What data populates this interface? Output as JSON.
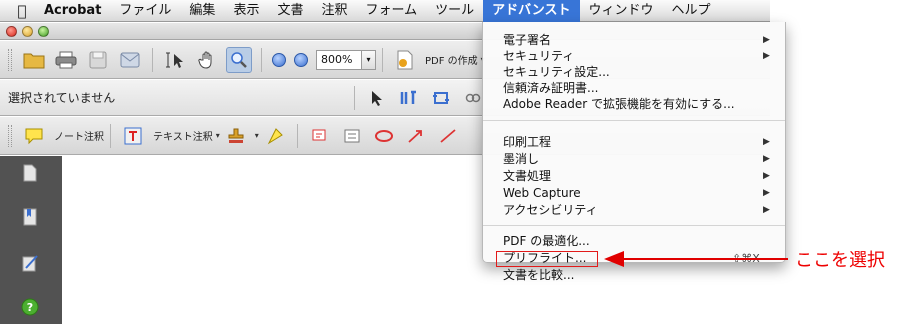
{
  "menubar": {
    "apple": "",
    "items": [
      "Acrobat",
      "ファイル",
      "編集",
      "表示",
      "文書",
      "注釈",
      "フォーム",
      "ツール",
      "アドバンスト",
      "ウィンドウ",
      "ヘルプ"
    ]
  },
  "toolbar1": {
    "zoom_value": "800%",
    "pdf_create_label": "PDF の作成"
  },
  "toolbar2": {
    "status": "選択されていません"
  },
  "toolbar3": {
    "note_comment": "ノート注釈",
    "text_edit_comment": "テキスト注釈"
  },
  "menu": {
    "group1": [
      {
        "label": "電子署名",
        "submenu": true
      },
      {
        "label": "セキュリティ",
        "submenu": true
      },
      {
        "label": "セキュリティ設定...",
        "submenu": false
      },
      {
        "label": "信頼済み証明書...",
        "submenu": false
      },
      {
        "label": "Adobe Reader で拡張機能を有効にする...",
        "submenu": false
      }
    ],
    "group2": [
      {
        "label": "印刷工程",
        "submenu": true
      },
      {
        "label": "墨消し",
        "submenu": true
      },
      {
        "label": "文書処理",
        "submenu": true
      },
      {
        "label": "Web Capture",
        "submenu": true
      },
      {
        "label": "アクセシビリティ",
        "submenu": true
      }
    ],
    "group3": [
      {
        "label": "PDF の最適化...",
        "submenu": false
      },
      {
        "label": "プリフライト...",
        "submenu": false,
        "shortcut": "⇧⌘X"
      },
      {
        "label": "文書を比較...",
        "submenu": false
      }
    ]
  },
  "annotation": {
    "text": "ここを選択",
    "color": "#e00000"
  },
  "colors": {
    "menu_highlight": "#3875d7",
    "sidebar": "#525252"
  }
}
